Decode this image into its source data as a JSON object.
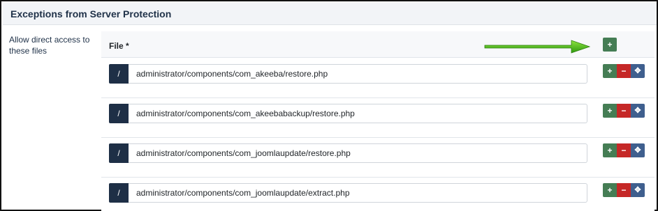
{
  "header": {
    "title": "Exceptions from Server Protection"
  },
  "field": {
    "label": "Allow direct access to these files"
  },
  "subform": {
    "column_label": "File *",
    "add_label": "+",
    "rows": [
      {
        "prefix": "/",
        "path": "administrator/components/com_akeeba/restore.php",
        "add": "+",
        "remove": "−",
        "move": "✥"
      },
      {
        "prefix": "/",
        "path": "administrator/components/com_akeebabackup/restore.php",
        "add": "+",
        "remove": "−",
        "move": "✥"
      },
      {
        "prefix": "/",
        "path": "administrator/components/com_joomlaupdate/restore.php",
        "add": "+",
        "remove": "−",
        "move": "✥"
      },
      {
        "prefix": "/",
        "path": "administrator/components/com_joomlaupdate/extract.php",
        "add": "+",
        "remove": "−",
        "move": "✥"
      }
    ]
  },
  "colors": {
    "header_text": "#1f3148",
    "prefix_bg": "#1e2f46",
    "add": "#457d54",
    "remove": "#c52827",
    "move": "#3f5f8e",
    "annotation_arrow": "#4fb81c"
  }
}
